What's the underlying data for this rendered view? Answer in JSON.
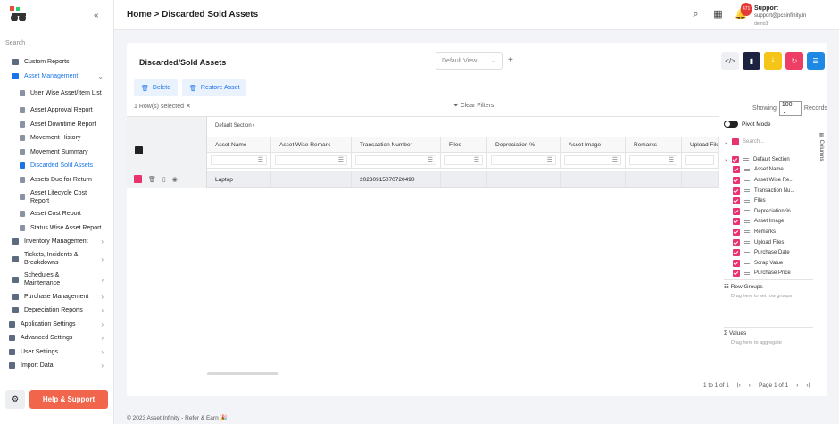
{
  "sidebar": {
    "search_placeholder": "Search",
    "items": [
      {
        "label": "Custom Reports"
      },
      {
        "label": "Asset Management"
      },
      {
        "label": "User Wise Asset/Item List"
      },
      {
        "label": "Asset Approval Report"
      },
      {
        "label": "Asset Downtime Report"
      },
      {
        "label": "Movement History"
      },
      {
        "label": "Movement Summary"
      },
      {
        "label": "Discarded Sold Assets"
      },
      {
        "label": "Assets Due for Return"
      },
      {
        "label": "Asset Lifecycle Cost Report"
      },
      {
        "label": "Asset Cost Report"
      },
      {
        "label": "Status Wise Asset Report"
      },
      {
        "label": "Inventory Management"
      },
      {
        "label": "Tickets, Incidents & Breakdowns"
      },
      {
        "label": "Schedules & Maintenance"
      },
      {
        "label": "Purchase Management"
      },
      {
        "label": "Depreciation Reports"
      },
      {
        "label": "Application Settings"
      },
      {
        "label": "Advanced Settings"
      },
      {
        "label": "User Settings"
      },
      {
        "label": "Import Data"
      }
    ],
    "help_label": "Help & Support"
  },
  "header": {
    "breadcrumb": "Home > Discarded Sold Assets",
    "notif_count": "471",
    "user_name": "Support",
    "user_email": "support@pcsinfinity.in",
    "user_sub": "demo3"
  },
  "panel": {
    "title": "Discarded/Sold Assets",
    "view": "Default View",
    "delete_label": "Delete",
    "restore_label": "Restore Asset",
    "rows_selected": "1 Row(s) selected",
    "clear_filters": "Clear Filters",
    "showing": "Showing",
    "page_size": "100",
    "records": "Records",
    "section": "Default Section",
    "columns": [
      "Asset Name",
      "Asset Wise Remark",
      "Transaction Number",
      "Files",
      "Depreciation %",
      "Asset Image",
      "Remarks",
      "Upload File"
    ],
    "row": {
      "asset_name": "Laptop",
      "transaction_number": "20230915070720490"
    },
    "pivot_mode": "Pivot Mode",
    "col_search": "Search...",
    "col_list": [
      "Default Section",
      "Asset Name",
      "Asset Wise Re...",
      "Transaction Nu...",
      "Files",
      "Depreciation %",
      "Asset Image",
      "Remarks",
      "Upload Files",
      "Purchase Date",
      "Scrap Value",
      "Purchase Price"
    ],
    "row_groups": "Row Groups",
    "row_groups_hint": "Drag here to set row groups",
    "values": "Values",
    "values_hint": "Drag here to aggregate",
    "columns_tab": "Columns",
    "pager_range": "1 to 1 of 1",
    "pager_page": "Page 1 of 1"
  },
  "footer": "© 2023  Asset Infinity - Refer & Earn 🎉",
  "colors": {
    "accent": "#1a73e8",
    "pink": "#e8336d",
    "help": "#f0654b"
  }
}
